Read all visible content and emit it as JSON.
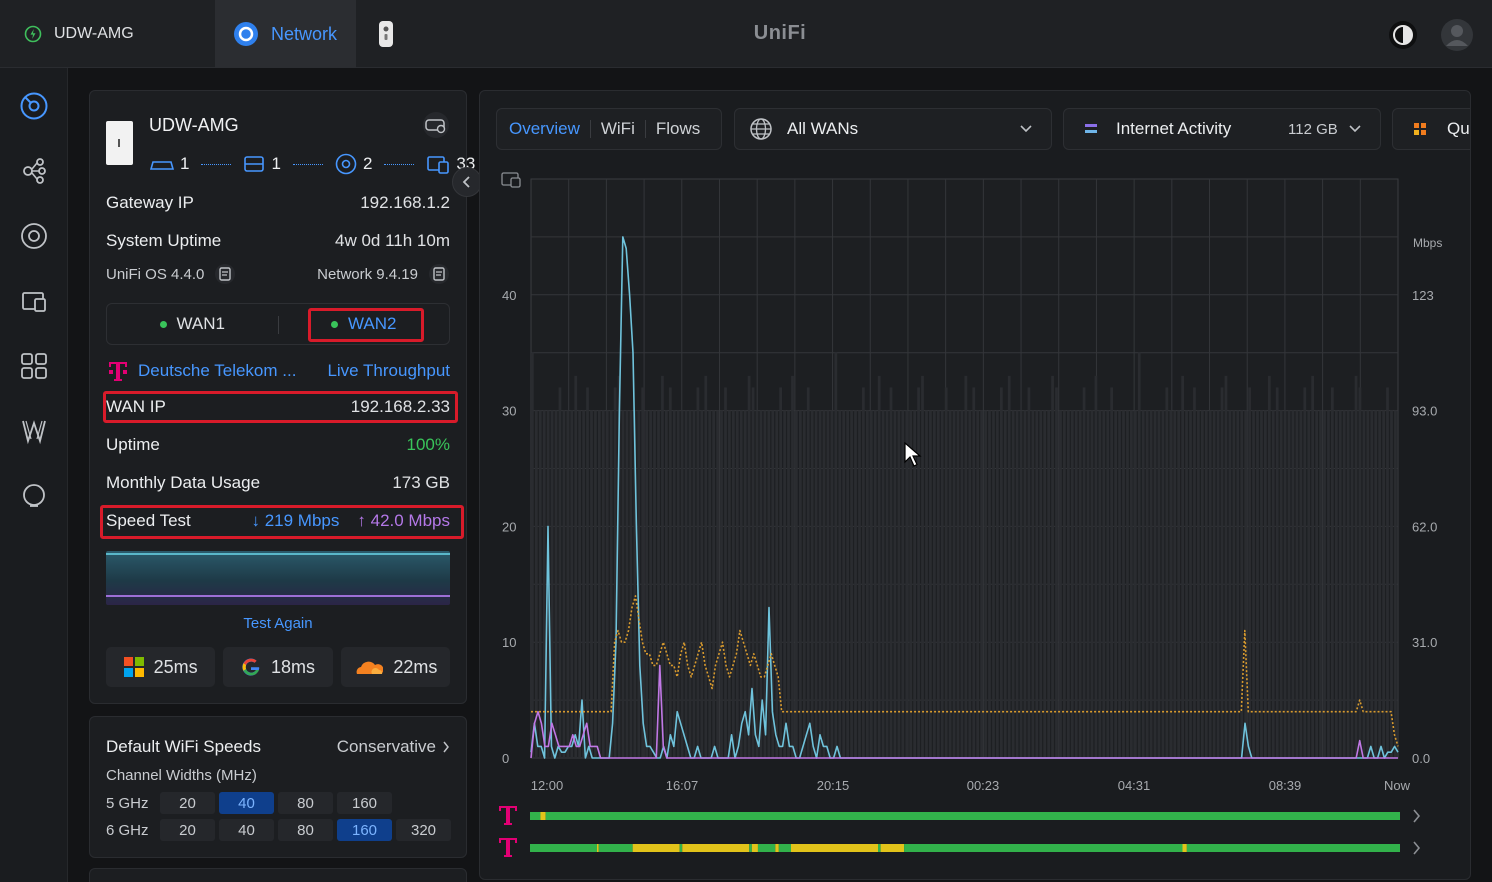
{
  "topbar": {
    "device_tab": "UDW-AMG",
    "network_tab": "Network",
    "brand": "UniFi"
  },
  "device": {
    "name": "UDW-AMG",
    "counts": {
      "wan": "1",
      "gateway": "1",
      "switches": "2",
      "clients": "33"
    },
    "gateway_ip_label": "Gateway IP",
    "gateway_ip": "192.168.1.2",
    "uptime_label": "System Uptime",
    "uptime": "4w 0d 11h 10m",
    "os_version": "UniFi OS 4.4.0",
    "network_version": "Network 9.4.19",
    "wan_tabs": [
      "WAN1",
      "WAN2"
    ],
    "isp": "Deutsche Telekom ...",
    "live_throughput": "Live Throughput",
    "wan_ip_label": "WAN IP",
    "wan_ip": "192.168.2.33",
    "wan_uptime_label": "Uptime",
    "wan_uptime": "100%",
    "monthly_usage_label": "Monthly Data Usage",
    "monthly_usage": "173 GB",
    "speed_test_label": "Speed Test",
    "download": "219 Mbps",
    "upload": "42.0 Mbps",
    "test_again": "Test Again",
    "pings": [
      {
        "service": "microsoft-icon",
        "value": "25ms"
      },
      {
        "service": "google-icon",
        "value": "18ms"
      },
      {
        "service": "cloudflare-icon",
        "value": "22ms"
      }
    ]
  },
  "wifi": {
    "title": "Default WiFi Speeds",
    "mode": "Conservative",
    "channel_label": "Channel Widths (MHz)",
    "bands": [
      {
        "name": "5 GHz",
        "widths": [
          "20",
          "40",
          "80",
          "160"
        ],
        "selected": "40"
      },
      {
        "name": "6 GHz",
        "widths": [
          "20",
          "40",
          "80",
          "160",
          "320"
        ],
        "selected": "160"
      }
    ]
  },
  "main": {
    "tabs": [
      "Overview",
      "WiFi",
      "Flows"
    ],
    "wan_select": "All WANs",
    "activity_label": "Internet Activity",
    "activity_total": "112 GB",
    "quick_label": "Qu"
  },
  "chart_data": {
    "type": "line",
    "x_labels": [
      "12:00",
      "16:07",
      "20:15",
      "00:23",
      "04:31",
      "08:39",
      "Now"
    ],
    "ylim_left": [
      0,
      50
    ],
    "y_ticks_left": [
      "0",
      "10",
      "20",
      "30",
      "40"
    ],
    "ylabel_right": "Mbps",
    "y_ticks_right": [
      "0.0",
      "31.0",
      "62.0",
      "93.0",
      "123"
    ],
    "series": [
      {
        "color": "#6fc3dc",
        "values": [
          0.5,
          3,
          1,
          1,
          0,
          20,
          1,
          0,
          1,
          0.5,
          0.5,
          1,
          1,
          2,
          1,
          5,
          0,
          1,
          0,
          0,
          0,
          0,
          0,
          0,
          3,
          10,
          30,
          45,
          44,
          40,
          35,
          20,
          8,
          3,
          1,
          1,
          0.5,
          0,
          0,
          1,
          0,
          2,
          1,
          4,
          3,
          2,
          1,
          0,
          0,
          1,
          0,
          0,
          0,
          0,
          1,
          0,
          0,
          0,
          0,
          2,
          0,
          1,
          3,
          4,
          2,
          6,
          2,
          1,
          5,
          2,
          13,
          4,
          2,
          1,
          1,
          3,
          1,
          1,
          0,
          0,
          1,
          2,
          3,
          1,
          0,
          2,
          1,
          1,
          0,
          0,
          1,
          0,
          0,
          0,
          0,
          0,
          0,
          0,
          0,
          0,
          0,
          0,
          0,
          0,
          0,
          0,
          0,
          0,
          0,
          0,
          0,
          0,
          0,
          0,
          0,
          0,
          0,
          0,
          0,
          0,
          0,
          0,
          0,
          0,
          0,
          0,
          0,
          0,
          0,
          0,
          0,
          0,
          0,
          0,
          0,
          0,
          0,
          0,
          0,
          0,
          0,
          0,
          0,
          0,
          0,
          0,
          0,
          0,
          0,
          0,
          0,
          0,
          0,
          0,
          0,
          0,
          0,
          0,
          0,
          0,
          0,
          0,
          0,
          0,
          0,
          0,
          0,
          0,
          0,
          0,
          0,
          0,
          0,
          0,
          0,
          0,
          0,
          0,
          0,
          0,
          0,
          0,
          0,
          0,
          0,
          0,
          0,
          0,
          0,
          0,
          0,
          0,
          0,
          0,
          0,
          0,
          0,
          0,
          0,
          0,
          0,
          0,
          0,
          0,
          0,
          0,
          0,
          0,
          0,
          0,
          3,
          1,
          0,
          0,
          0,
          0,
          0,
          0,
          0,
          0,
          0,
          0,
          0,
          0,
          0,
          0,
          0,
          0,
          0,
          0,
          0,
          0,
          0,
          0,
          0,
          0,
          0,
          0,
          0,
          0,
          0,
          0,
          0,
          0,
          0,
          0,
          0,
          1,
          0,
          0,
          1,
          0,
          0.5,
          0.5,
          1,
          0.5
        ]
      },
      {
        "color": "#d99b2e",
        "values": [
          4,
          4,
          4,
          4,
          4,
          4,
          4,
          4,
          4,
          4,
          4,
          4,
          4,
          4,
          4,
          4,
          4,
          4,
          4,
          4,
          4,
          4,
          4,
          4,
          10,
          11,
          10,
          10,
          11,
          13,
          14,
          12,
          10,
          9,
          9,
          8,
          8,
          9,
          10,
          9,
          8,
          8,
          7,
          9,
          10,
          8,
          7,
          8,
          9,
          10,
          8,
          7,
          6,
          8,
          9,
          10,
          8,
          7,
          8,
          9,
          11,
          10,
          9,
          8,
          9,
          8,
          7,
          7,
          8,
          9,
          8,
          7,
          4,
          4,
          4,
          4,
          4,
          4,
          4,
          4,
          4,
          4,
          4,
          4,
          4,
          4,
          4,
          4,
          4,
          4,
          4,
          4,
          4,
          4,
          4,
          4,
          4,
          4,
          4,
          4,
          4,
          4,
          4,
          4,
          4,
          4,
          4,
          4,
          4,
          4,
          4,
          4,
          4,
          4,
          4,
          4,
          4,
          4,
          4,
          4,
          4,
          4,
          4,
          4,
          4,
          4,
          4,
          4,
          4,
          4,
          4,
          4,
          4,
          4,
          4,
          4,
          4,
          4,
          4,
          4,
          4,
          4,
          4,
          4,
          4,
          4,
          4,
          4,
          4,
          4,
          4,
          4,
          4,
          4,
          4,
          4,
          4,
          4,
          4,
          4,
          4,
          4,
          4,
          4,
          4,
          4,
          4,
          4,
          4,
          4,
          4,
          4,
          4,
          4,
          4,
          4,
          4,
          4,
          4,
          4,
          4,
          4,
          4,
          4,
          4,
          4,
          4,
          4,
          4,
          4,
          4,
          4,
          4,
          4,
          4,
          4,
          4,
          4,
          4,
          4,
          4,
          4,
          4,
          4,
          4,
          11,
          4,
          4,
          4,
          4,
          4,
          4,
          4,
          4,
          4,
          4,
          4,
          4,
          4,
          4,
          4,
          4,
          4,
          4,
          4,
          4,
          4,
          4,
          4,
          4,
          4,
          4,
          4,
          4,
          4,
          4,
          4,
          4,
          5,
          4,
          4,
          4,
          4,
          4,
          4,
          4,
          4,
          4,
          2,
          1
        ]
      },
      {
        "color": "#c178e6",
        "values": [
          0,
          3,
          4,
          3,
          1,
          1,
          3,
          2,
          1,
          1,
          1,
          1,
          2,
          1,
          1,
          2,
          3,
          1,
          1,
          1,
          0,
          0,
          0,
          0,
          0,
          0,
          0,
          0,
          0,
          0,
          0,
          0,
          0,
          0,
          0,
          0,
          0,
          8,
          1,
          0,
          0,
          0,
          0,
          0,
          0,
          0,
          0,
          0,
          0,
          0,
          0,
          0,
          0,
          0,
          0,
          0,
          0,
          0,
          0,
          0,
          0,
          0,
          0,
          0,
          0,
          0,
          0,
          0,
          0,
          0,
          0,
          0,
          0,
          0,
          0,
          0,
          0,
          0,
          0,
          0,
          0,
          0,
          0,
          0,
          0,
          0,
          0,
          0,
          0,
          0,
          0,
          0,
          0,
          0,
          0,
          0,
          0,
          0,
          0,
          0,
          0,
          0,
          0,
          0,
          0,
          0,
          0,
          0,
          0,
          0,
          0,
          0,
          0,
          0,
          0,
          0,
          0,
          0,
          0,
          0,
          0,
          0,
          0,
          0,
          0,
          0,
          0,
          0,
          0,
          0,
          0,
          0,
          0,
          0,
          0,
          0,
          0,
          0,
          0,
          0,
          0,
          0,
          0,
          0,
          0,
          0,
          0,
          0,
          0,
          0,
          0,
          0,
          0,
          0,
          0,
          0,
          0,
          0,
          0,
          0,
          0,
          0,
          0,
          0,
          0,
          0,
          0,
          0,
          0,
          0,
          0,
          0,
          0,
          0,
          0,
          0,
          0,
          0,
          0,
          0,
          0,
          0,
          0,
          0,
          0,
          0,
          0,
          0,
          0,
          0,
          0,
          0,
          0,
          0,
          0,
          0,
          0,
          0,
          0,
          0,
          0,
          0,
          0,
          0,
          0,
          0,
          0,
          0,
          0,
          0,
          0,
          0,
          0,
          0,
          0,
          0,
          0,
          0,
          0,
          0,
          0,
          0,
          0,
          0,
          0,
          0,
          0,
          0,
          0,
          0,
          0,
          0,
          0,
          0,
          0,
          0,
          0,
          0,
          1.5,
          0,
          0,
          0,
          0,
          0,
          0,
          0,
          0,
          0,
          0,
          0
        ]
      }
    ]
  },
  "uptime_bars": [
    {
      "isp": "telekom-icon",
      "segments": [
        [
          0,
          0.012,
          "#32b24b"
        ],
        [
          0.012,
          0.018,
          "#e2c31a"
        ],
        [
          0.018,
          1,
          "#32b24b"
        ]
      ]
    },
    {
      "isp": "telekom-icon",
      "segments": [
        [
          0,
          0.077,
          "#32b24b"
        ],
        [
          0.077,
          0.079,
          "#e2c31a"
        ],
        [
          0.079,
          0.118,
          "#32b24b"
        ],
        [
          0.118,
          0.172,
          "#e2c31a"
        ],
        [
          0.172,
          0.175,
          "#32b24b"
        ],
        [
          0.175,
          0.252,
          "#e2c31a"
        ],
        [
          0.252,
          0.255,
          "#32b24b"
        ],
        [
          0.255,
          0.262,
          "#e2c31a"
        ],
        [
          0.262,
          0.282,
          "#32b24b"
        ],
        [
          0.282,
          0.286,
          "#e2c31a"
        ],
        [
          0.286,
          0.3,
          "#32b24b"
        ],
        [
          0.3,
          0.4,
          "#e2c31a"
        ],
        [
          0.4,
          0.403,
          "#32b24b"
        ],
        [
          0.403,
          0.43,
          "#e2c31a"
        ],
        [
          0.43,
          0.75,
          "#32b24b"
        ],
        [
          0.75,
          0.755,
          "#e2c31a"
        ],
        [
          0.755,
          1,
          "#32b24b"
        ]
      ]
    }
  ]
}
